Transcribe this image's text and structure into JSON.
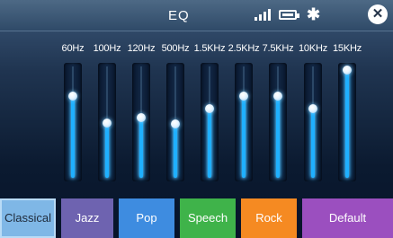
{
  "header": {
    "title": "EQ"
  },
  "status_icons": [
    "signal-icon",
    "battery-icon",
    "bluetooth-icon"
  ],
  "bluetooth_glyph": "✱",
  "close_glyph": "✕",
  "bands": [
    {
      "label": "60Hz",
      "level": 0.73
    },
    {
      "label": "100Hz",
      "level": 0.49
    },
    {
      "label": "120Hz",
      "level": 0.54
    },
    {
      "label": "500Hz",
      "level": 0.48
    },
    {
      "label": "1.5KHz",
      "level": 0.62
    },
    {
      "label": "2.5KHz",
      "level": 0.73
    },
    {
      "label": "7.5KHz",
      "level": 0.73
    },
    {
      "label": "10KHz",
      "level": 0.62
    },
    {
      "label": "15KHz",
      "level": 0.97
    }
  ],
  "presets": [
    {
      "label": "Classical",
      "color": "#7fb7e6",
      "selected": true
    },
    {
      "label": "Jazz",
      "color": "#6e63b0",
      "selected": false
    },
    {
      "label": "Pop",
      "color": "#3e8ce0",
      "selected": false
    },
    {
      "label": "Speech",
      "color": "#3fb34a",
      "selected": false
    },
    {
      "label": "Rock",
      "color": "#f58a22",
      "selected": false
    },
    {
      "label": "Default",
      "color": "#9b4fbf",
      "selected": false
    }
  ]
}
